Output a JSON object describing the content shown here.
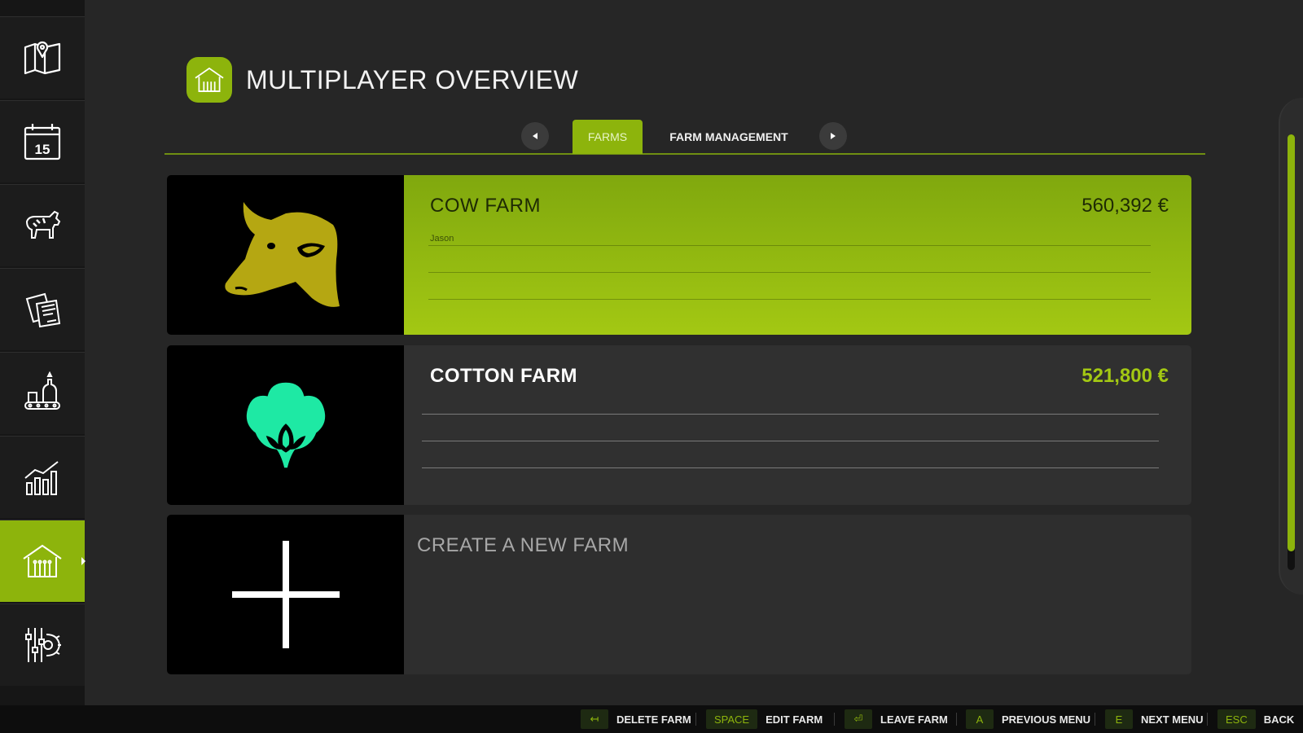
{
  "page": {
    "title": "MULTIPLAYER OVERVIEW",
    "icon": "farmhouse-icon"
  },
  "sidebar": {
    "items": [
      {
        "icon": "map-icon",
        "active": false
      },
      {
        "icon": "calendar-icon",
        "label": "15",
        "active": false
      },
      {
        "icon": "animals-icon",
        "active": false
      },
      {
        "icon": "contracts-icon",
        "active": false
      },
      {
        "icon": "production-icon",
        "active": false
      },
      {
        "icon": "statistics-icon",
        "active": false
      },
      {
        "icon": "farmhouse-icon",
        "active": true
      },
      {
        "icon": "settings-icon",
        "active": false
      }
    ]
  },
  "tabs": {
    "items": [
      "FARMS",
      "FARM MANAGEMENT"
    ],
    "active": "FARMS"
  },
  "farms": [
    {
      "name": "COW FARM",
      "money": "560,392 €",
      "members": [
        "Jason"
      ],
      "icon": "cow-head-icon",
      "selected": true
    },
    {
      "name": "COTTON FARM",
      "money": "521,800 €",
      "members": [],
      "icon": "cotton-icon",
      "selected": false
    }
  ],
  "new_farm": {
    "label": "CREATE A NEW FARM",
    "icon": "plus-icon"
  },
  "footer": {
    "hints": [
      {
        "key": "↤",
        "label": "DELETE FARM"
      },
      {
        "key": "SPACE",
        "label": "EDIT FARM"
      },
      {
        "key": "⏎",
        "label": "LEAVE FARM"
      },
      {
        "key": "A",
        "label": "PREVIOUS MENU"
      },
      {
        "key": "E",
        "label": "NEXT MENU"
      },
      {
        "key": "ESC",
        "label": "BACK"
      }
    ]
  },
  "colors": {
    "accent": "#8db40c",
    "background": "#262626",
    "cotton_icon": "#1ee9a4",
    "cow_icon": "#b5a712"
  }
}
